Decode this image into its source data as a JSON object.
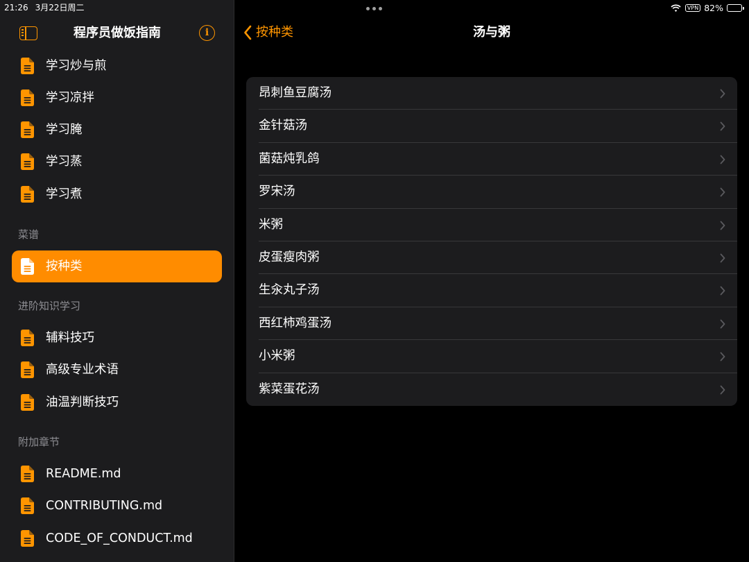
{
  "status_bar": {
    "time": "21:26",
    "date": "3月22日周二",
    "vpn": "VPN",
    "battery": "82%",
    "battery_level": 0.82
  },
  "colors": {
    "accent": "#ff9500",
    "selected_bg": "#ff8c00",
    "sidebar_bg": "#1c1c1e",
    "list_bg": "#1c1c1e",
    "section_text": "#8e8e93"
  },
  "sidebar": {
    "title": "程序员做饭指南",
    "toggle_icon": "sidebar-toggle-icon",
    "info_icon": "info-icon",
    "info_glyph": "i",
    "top_items": [
      {
        "label": "学习炒与煎",
        "icon": "document-icon"
      },
      {
        "label": "学习凉拌",
        "icon": "document-icon"
      },
      {
        "label": "学习腌",
        "icon": "document-icon"
      },
      {
        "label": "学习蒸",
        "icon": "document-icon"
      },
      {
        "label": "学习煮",
        "icon": "document-icon"
      }
    ],
    "sections": [
      {
        "title": "菜谱",
        "items": [
          {
            "label": "按种类",
            "icon": "document-icon",
            "selected": true
          }
        ]
      },
      {
        "title": "进阶知识学习",
        "items": [
          {
            "label": "辅料技巧",
            "icon": "document-icon"
          },
          {
            "label": "高级专业术语",
            "icon": "document-icon"
          },
          {
            "label": "油温判断技巧",
            "icon": "document-icon"
          }
        ]
      },
      {
        "title": "附加章节",
        "items": [
          {
            "label": "README.md",
            "icon": "document-icon"
          },
          {
            "label": "CONTRIBUTING.md",
            "icon": "document-icon"
          },
          {
            "label": "CODE_OF_CONDUCT.md",
            "icon": "document-icon"
          }
        ]
      }
    ]
  },
  "main": {
    "back_label": "按种类",
    "title": "汤与粥",
    "items": [
      "昂刺鱼豆腐汤",
      "金针菇汤",
      "菌菇炖乳鸽",
      "罗宋汤",
      "米粥",
      "皮蛋瘦肉粥",
      "生汆丸子汤",
      "西红柿鸡蛋汤",
      "小米粥",
      "紫菜蛋花汤"
    ]
  }
}
